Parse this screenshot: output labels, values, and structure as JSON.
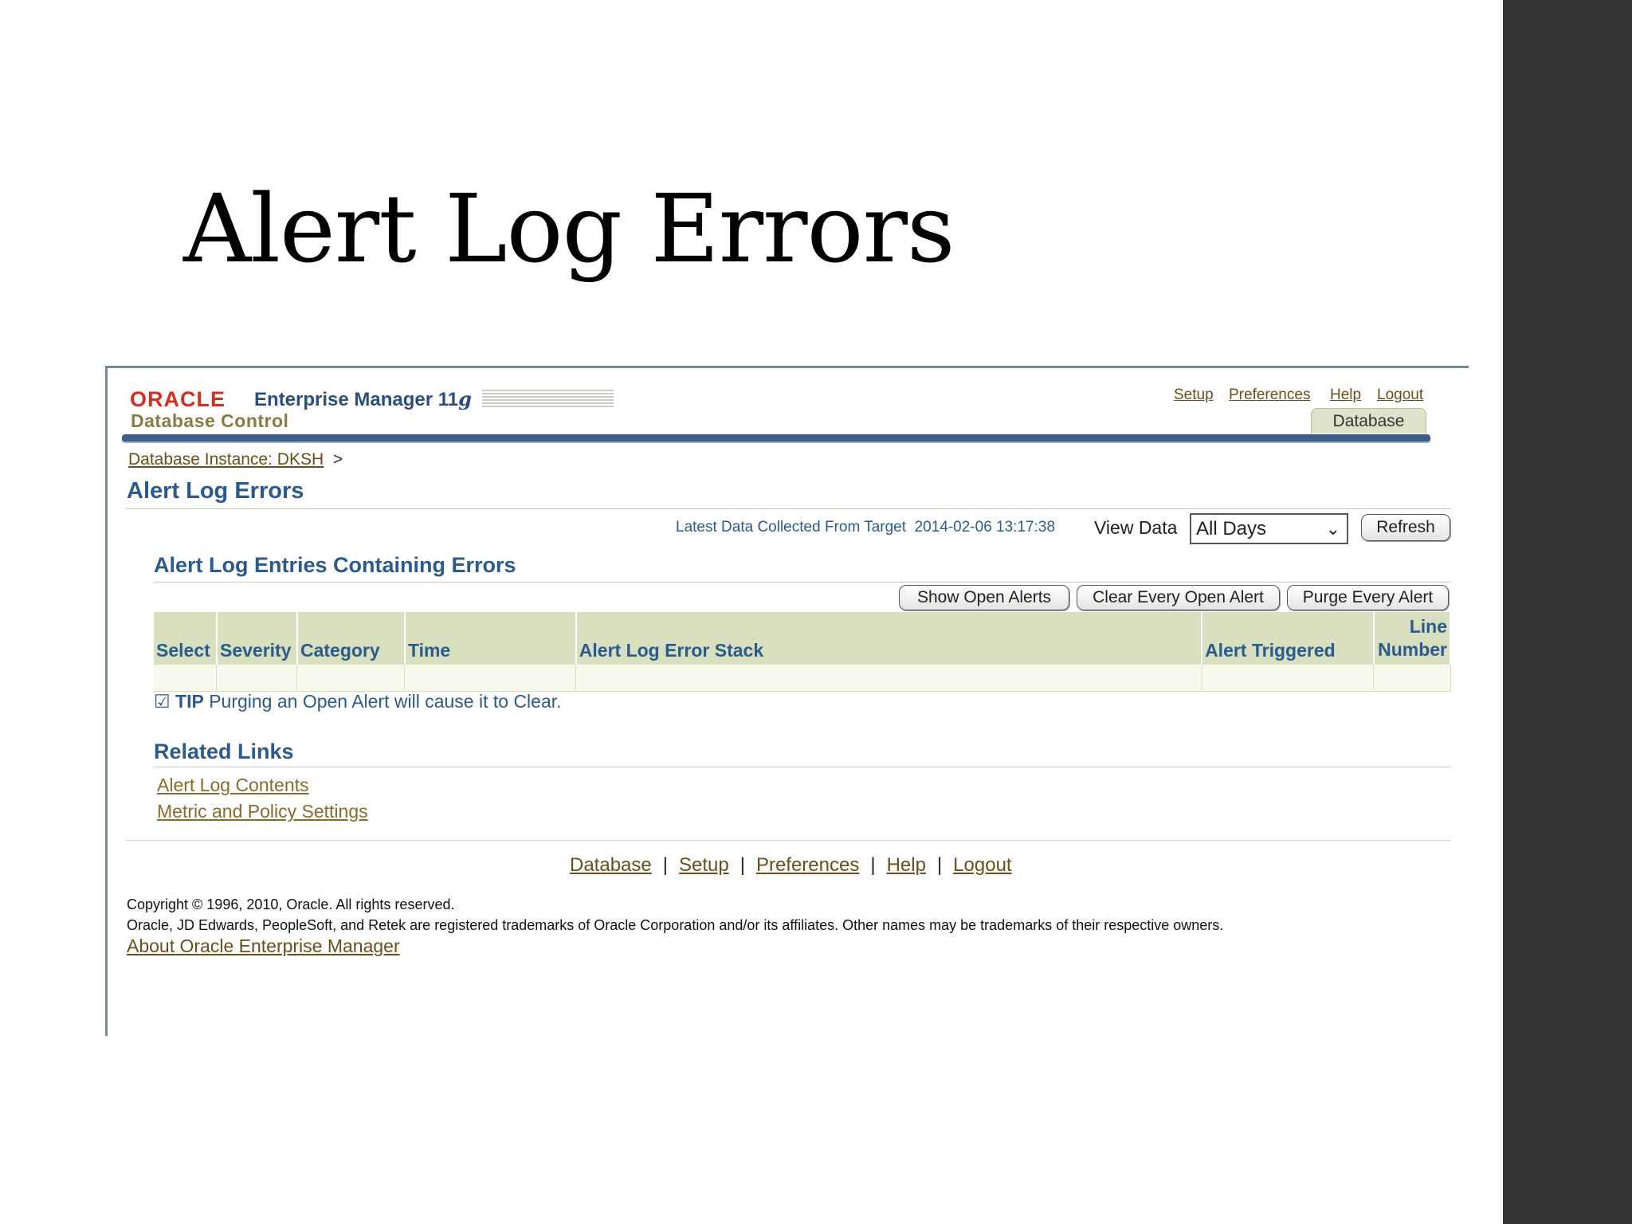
{
  "slide": {
    "title": "Alert Log Errors"
  },
  "header": {
    "brand_oracle": "ORACLE",
    "brand_product": "Enterprise Manager 11",
    "brand_version_suffix": "g",
    "brand_sub": "Database Control",
    "global_links": [
      "Setup",
      "Preferences",
      "Help",
      "Logout"
    ],
    "active_tab": "Database"
  },
  "breadcrumb": {
    "link": "Database Instance: DKSH",
    "separator": ">"
  },
  "page": {
    "title": "Alert Log Errors",
    "collected_label": "Latest Data Collected From Target",
    "collected_value": "2014-02-06 13:17:38",
    "view_data_label": "View Data",
    "view_data_selected": "All Days",
    "refresh_label": "Refresh"
  },
  "entries": {
    "title": "Alert Log Entries Containing Errors",
    "buttons": [
      "Show Open Alerts",
      "Clear Every Open Alert",
      "Purge Every Alert"
    ],
    "columns": [
      "Select",
      "Severity",
      "Category",
      "Time",
      "Alert Log Error Stack",
      "Alert Triggered",
      "Line Number"
    ]
  },
  "tip": {
    "label": "TIP",
    "text": "Purging an Open Alert will cause it to Clear."
  },
  "related": {
    "title": "Related Links",
    "links": [
      "Alert Log Contents",
      "Metric and Policy Settings"
    ]
  },
  "footer": {
    "links": [
      "Database",
      "Setup",
      "Preferences",
      "Help",
      "Logout"
    ],
    "copyright": "Copyright © 1996, 2010, Oracle. All rights reserved.",
    "trademark": "Oracle, JD Edwards, PeopleSoft, and Retek are registered trademarks of Oracle Corporation and/or its affiliates. Other names may be trademarks of their respective owners.",
    "about": "About Oracle Enterprise Manager"
  }
}
